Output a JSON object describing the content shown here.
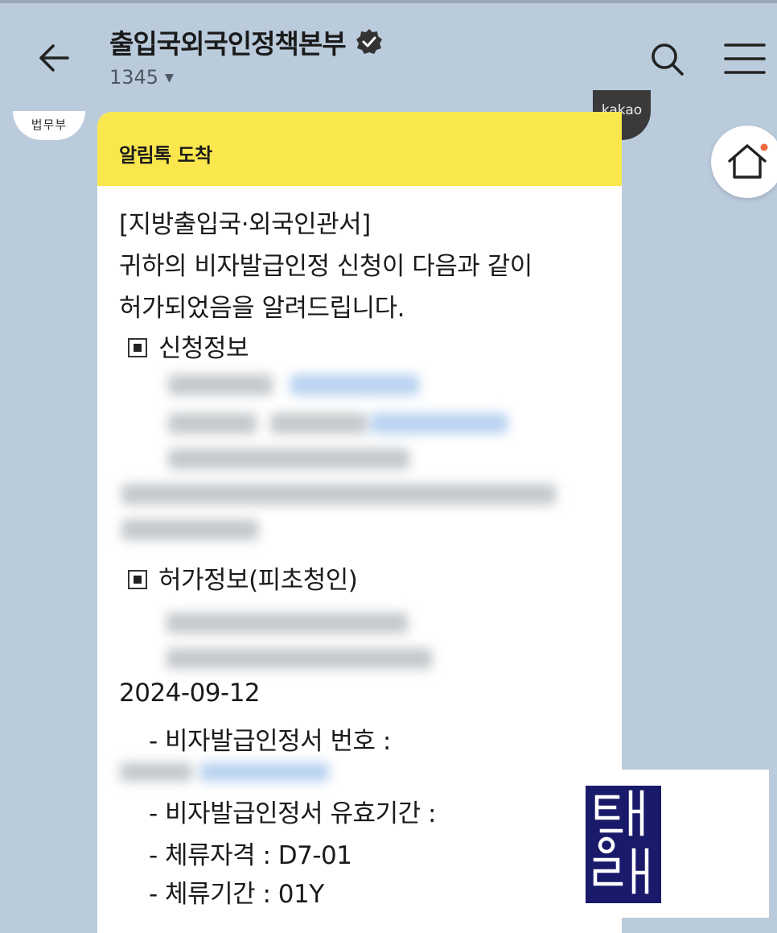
{
  "header": {
    "title": "출입국외국인정책본부",
    "subtitle": "1345"
  },
  "profile": {
    "label": "법무부"
  },
  "badge": {
    "label": "kakao"
  },
  "message": {
    "head": "알림톡 도착",
    "office": "[지방출입국·외국인관서]",
    "line1": "귀하의 비자발급인정 신청이 다음과 같이",
    "line2": "허가되었음을 알려드립니다.",
    "section1": "신청정보",
    "section2": "허가정보(피초청인)",
    "date": "2024-09-12",
    "item_number": "- 비자발급인정서 번호 :",
    "item_valid": "- 비자발급인정서 유효기간 :",
    "item_status": "- 체류자격 : D7-01",
    "item_period": "- 체류기간 : 01Y"
  },
  "colors": {
    "background": "#bacbdc",
    "header_yellow": "#fae74e",
    "logo_navy": "#1a1a6b"
  }
}
